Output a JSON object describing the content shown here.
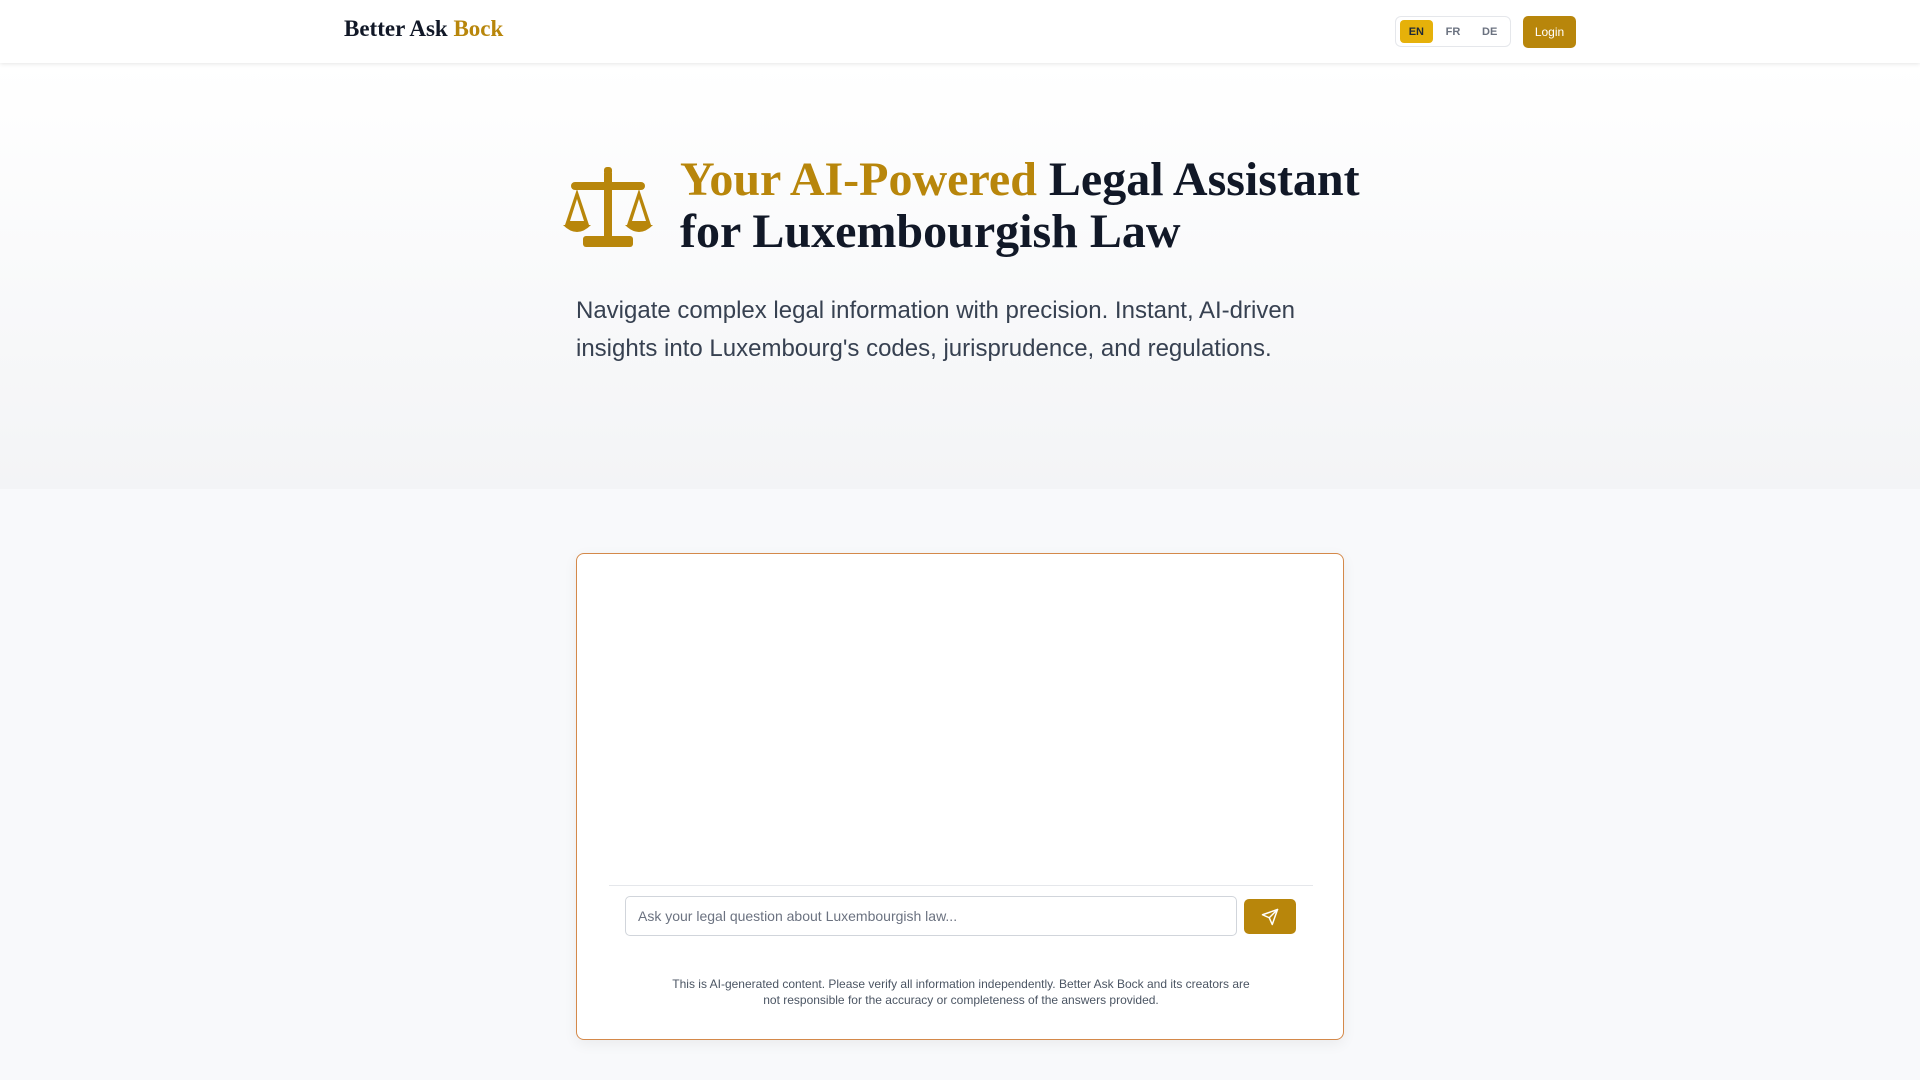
{
  "header": {
    "brand_part1": "Better Ask",
    "brand_part2": "Bock",
    "languages": [
      "EN",
      "FR",
      "DE"
    ],
    "active_language": "EN",
    "login_label": "Login"
  },
  "hero": {
    "title_accent": "Your AI-Powered",
    "title_rest": "Legal Assistant for Luxembourgish Law",
    "subtitle": "Navigate complex legal information with precision. Instant, AI-driven insights into Luxembourg's codes, jurisprudence, and regulations.",
    "icon": "scale-of-justice-icon"
  },
  "chat": {
    "input_placeholder": "Ask your legal question about Luxembourgish law...",
    "input_value": "",
    "send_icon": "send-icon",
    "disclaimer": "This is AI-generated content. Please verify all information independently. Better Ask Bock and its creators are not responsible for the accuracy or completeness of the answers provided."
  },
  "colors": {
    "accent": "#b8860b",
    "active_lang_bg": "#e6b10a",
    "card_border": "#d4894a",
    "title_dark": "#111827"
  }
}
